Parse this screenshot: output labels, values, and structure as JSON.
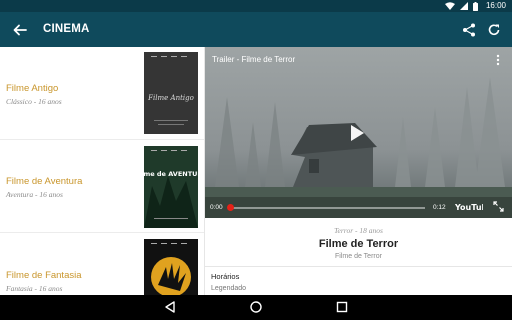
{
  "status_bar": {
    "time": "16:00",
    "icons": [
      "wifi-icon",
      "signal-icon",
      "battery-icon"
    ]
  },
  "app_bar": {
    "title": "CINEMA",
    "icons": [
      "back-arrow-icon",
      "share-icon",
      "refresh-icon"
    ]
  },
  "movies": [
    {
      "name": "Filme Antigo",
      "meta": "Clássico - 16 anos",
      "poster_text": "Filme Antigo",
      "poster_icon": "poster-antigo-icon"
    },
    {
      "name": "Filme de Aventura",
      "meta": "Aventura - 16 anos",
      "poster_text": "Filme de AVENTURA",
      "poster_icon": "poster-aventura-icon"
    },
    {
      "name": "Filme de Fantasia",
      "meta": "Fantasia - 16 anos",
      "poster_icon": "poster-fantasia-icon"
    }
  ],
  "video": {
    "title": "Trailer - Filme de Terror",
    "time_current": "0:00",
    "time_total": "0:12",
    "progress": 0,
    "brand": "YouTube"
  },
  "details": {
    "genre": "Terror - 18 anos",
    "title": "Filme de Terror",
    "subtitle": "Filme de Terror",
    "section_title": "Horários",
    "section_line": "Legendado"
  },
  "colors": {
    "app_bar": "#0f4a5c",
    "status_bar": "#0b3a49",
    "accent_title": "#c9962c",
    "progress_knob": "#e62117"
  },
  "nav_bar": {
    "icons": [
      "back-triangle-icon",
      "home-circle-icon",
      "recents-square-icon"
    ]
  }
}
